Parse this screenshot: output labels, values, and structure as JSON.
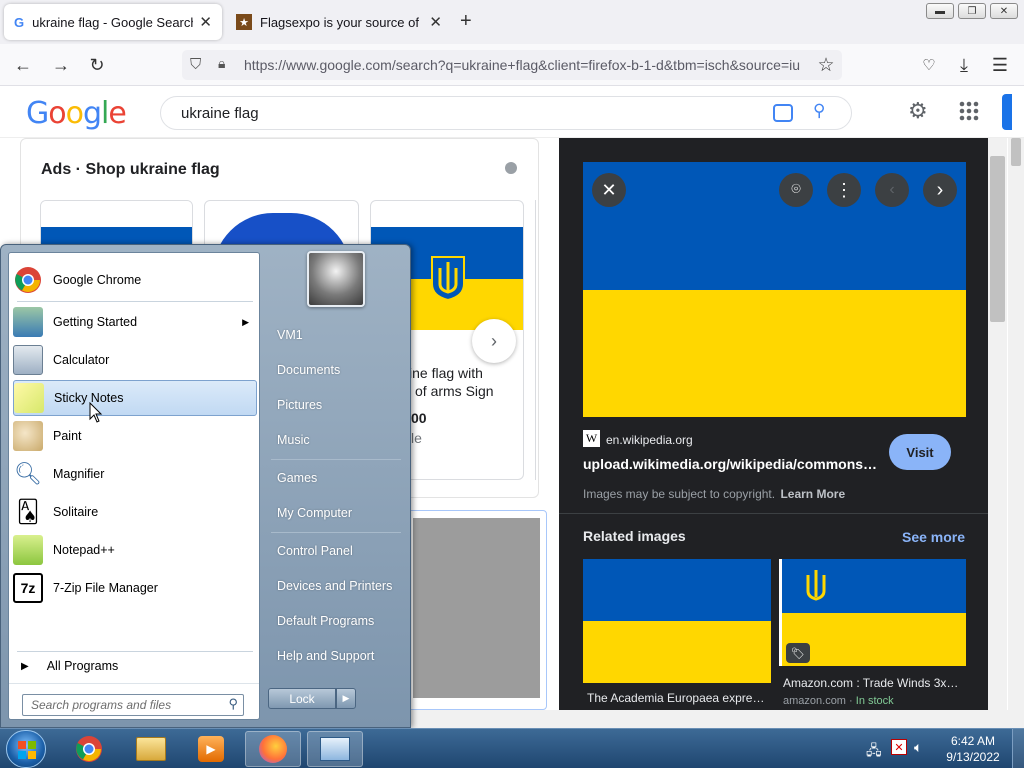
{
  "browser": {
    "tabs": [
      {
        "title": "ukraine flag - Google Search",
        "favicon": "G"
      },
      {
        "title": "Flagsexpo is your source of USA",
        "favicon": "★"
      }
    ],
    "url": "https://www.google.com/search?q=ukraine+flag&client=firefox-b-1-d&tbm=isch&source=iu"
  },
  "google": {
    "logo": "Google",
    "query": "ukraine flag"
  },
  "ads": {
    "title": "Ads · Shop ukraine flag",
    "product_title": "ine flag with\nof arms Sign",
    "product_title_l1": "ine flag with",
    "product_title_l2": "of arms Sign",
    "price_fragment": "00",
    "seller_fragment": "le"
  },
  "panel": {
    "source_letter": "W",
    "source_site": "en.wikipedia.org",
    "source_title": "upload.wikimedia.org/wikipedia/commons…",
    "visit_label": "Visit",
    "copyright": "Images may be subject to copyright.",
    "learn_more": "Learn More",
    "related_title": "Related images",
    "see_more": "See more",
    "related": [
      {
        "caption": "The Academia Europaea expre…",
        "meta": ""
      },
      {
        "caption": "Amazon.com : Trade Winds 3x…",
        "meta_site": "amazon.com",
        "meta_stock": "In stock"
      }
    ]
  },
  "start_menu": {
    "left_items": [
      {
        "label": "Google Chrome"
      },
      {
        "label": "Getting Started"
      },
      {
        "label": "Calculator"
      },
      {
        "label": "Sticky Notes"
      },
      {
        "label": "Paint"
      },
      {
        "label": "Magnifier"
      },
      {
        "label": "Solitaire"
      },
      {
        "label": "Notepad++"
      },
      {
        "label": "7-Zip File Manager"
      }
    ],
    "all_programs": "All Programs",
    "search_placeholder": "Search programs and files",
    "right_items": [
      {
        "label": "VM1"
      },
      {
        "label": "Documents"
      },
      {
        "label": "Pictures"
      },
      {
        "label": "Music"
      },
      {
        "label": "Games"
      },
      {
        "label": "My Computer"
      },
      {
        "label": "Control Panel"
      },
      {
        "label": "Devices and Printers"
      },
      {
        "label": "Default Programs"
      },
      {
        "label": "Help and Support"
      }
    ],
    "lock_label": "Lock"
  },
  "taskbar": {
    "time": "6:42 AM",
    "date": "9/13/2022"
  },
  "colors": {
    "flag_blue": "#0057b7",
    "flag_yellow": "#ffd700",
    "link_blue": "#8ab4f8"
  }
}
